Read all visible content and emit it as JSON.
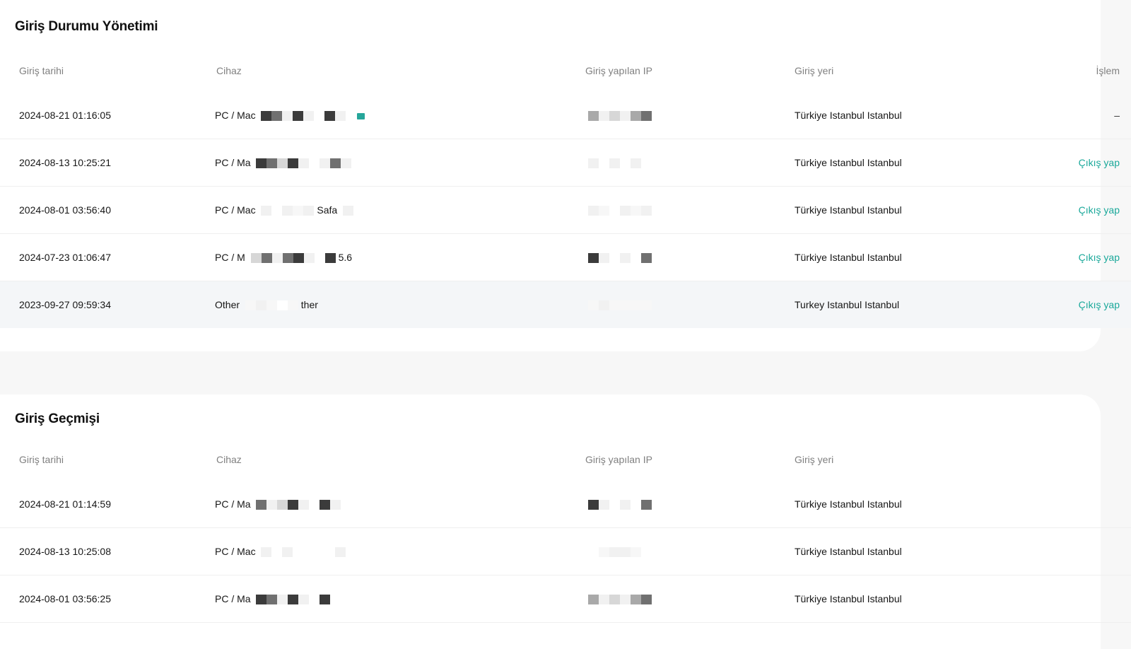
{
  "sessions": {
    "title": "Giriş Durumu Yönetimi",
    "columns": [
      "Giriş tarihi",
      "Cihaz",
      "Giriş yapılan IP",
      "Giriş yeri",
      "İşlem"
    ],
    "rows": [
      {
        "date": "2024-08-21 01:16:05",
        "device": "PC / Mac",
        "location": "Türkiye Istanbul Istanbul",
        "action": "–"
      },
      {
        "date": "2024-08-13 10:25:21",
        "device": "PC / Ma",
        "location": "Türkiye Istanbul Istanbul",
        "action": "Çıkış yap"
      },
      {
        "date": "2024-08-01 03:56:40",
        "device": "PC / Mac",
        "device_suffix": "Safa",
        "location": "Türkiye Istanbul Istanbul",
        "action": "Çıkış yap"
      },
      {
        "date": "2024-07-23 01:06:47",
        "device": "PC / M",
        "device_suffix": "5.6",
        "location": "Türkiye Istanbul Istanbul",
        "action": "Çıkış yap"
      },
      {
        "date": "2023-09-27 09:59:34",
        "device": "Other",
        "device_suffix": "ther",
        "location": "Turkey Istanbul Istanbul",
        "action": "Çıkış yap"
      }
    ]
  },
  "history": {
    "title": "Giriş Geçmişi",
    "columns": [
      "Giriş tarihi",
      "Cihaz",
      "Giriş yapılan IP",
      "Giriş yeri"
    ],
    "rows": [
      {
        "date": "2024-08-21 01:14:59",
        "device": "PC / Ma",
        "location": "Türkiye Istanbul Istanbul"
      },
      {
        "date": "2024-08-13 10:25:08",
        "device": "PC / Mac",
        "location": "Türkiye Istanbul Istanbul"
      },
      {
        "date": "2024-08-01 03:56:25",
        "device": "PC / Ma",
        "location": "Türkiye Istanbul Istanbul"
      }
    ]
  },
  "colors": {
    "accent": "#1aa89a",
    "highlight_row": "#f4f6f8",
    "header_text": "#808080"
  }
}
